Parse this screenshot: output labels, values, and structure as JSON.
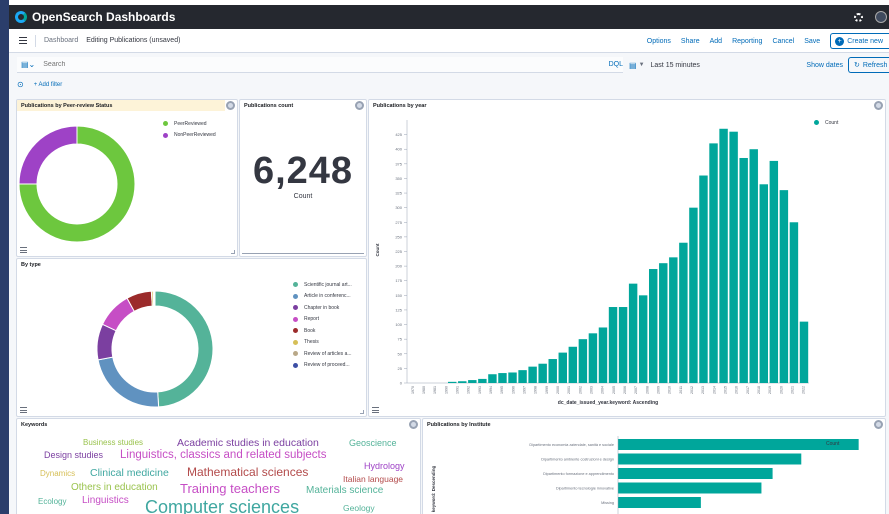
{
  "app": {
    "name": "OpenSearch Dashboards"
  },
  "breadcrumbs": [
    "Dashboard",
    "Editing Publications (unsaved)"
  ],
  "nav_actions": [
    "Options",
    "Share",
    "Add",
    "Reporting",
    "Cancel",
    "Save"
  ],
  "create_button": "Create new",
  "query": {
    "placeholder": "Search",
    "language": "DQL"
  },
  "time": {
    "range": "Last 15 minutes",
    "show_dates": "Show dates",
    "refresh": "Refresh"
  },
  "filters": {
    "add_label": "+ Add filter"
  },
  "colors": {
    "header": "#25282f",
    "link": "#006bb8",
    "teal": "#54b399",
    "bar": "#00a69b"
  },
  "panels": {
    "peer_review": {
      "title": "Publications by Peer-review Status",
      "chart_data": {
        "type": "pie",
        "labels": [
          "PeerReviewed",
          "NonPeerReviewed"
        ],
        "values": [
          75,
          25
        ],
        "colors": [
          "#6dc73e",
          "#9e42c6"
        ],
        "legend": "top-right"
      }
    },
    "count": {
      "title": "Publications count",
      "value": "6,248",
      "label": "Count"
    },
    "by_year": {
      "title": "Publications by year",
      "chart_data": {
        "type": "bar",
        "categories": [
          "1970",
          "1980",
          "1981",
          "1990",
          "1991",
          "1992",
          "1993",
          "1994",
          "1995",
          "1996",
          "1997",
          "1998",
          "1999",
          "2000",
          "2001",
          "2002",
          "2003",
          "2004",
          "2005",
          "2006",
          "2007",
          "2008",
          "2009",
          "2010",
          "2011",
          "2012",
          "2013",
          "2014",
          "2015",
          "2016",
          "2017",
          "2018",
          "2019",
          "2020",
          "2021",
          "2022"
        ],
        "values": [
          0,
          0,
          0,
          0,
          2,
          3,
          5,
          7,
          15,
          17,
          18,
          22,
          28,
          33,
          41,
          52,
          62,
          75,
          85,
          95,
          130,
          130,
          170,
          150,
          195,
          205,
          215,
          240,
          300,
          355,
          410,
          435,
          430,
          385,
          400,
          340,
          380,
          330,
          275,
          105
        ],
        "ylabel": "Count",
        "xlabel": "dc_date_issued_year.keyword: Ascending",
        "yticks": [
          0,
          25,
          50,
          75,
          100,
          125,
          150,
          175,
          200,
          225,
          250,
          275,
          300,
          325,
          350,
          375,
          400,
          425
        ],
        "ylim": [
          0,
          450
        ],
        "series": [
          {
            "name": "Count",
            "color": "#00a69b"
          }
        ],
        "legend": "top-right"
      }
    },
    "by_type": {
      "title": "By type",
      "chart_data": {
        "type": "pie",
        "labels": [
          "Scientific journal art...",
          "Article in conferenc...",
          "Chapter in book",
          "Report",
          "Book",
          "Thesis",
          "Review of articles a...",
          "Review of proceed..."
        ],
        "values": [
          49,
          23,
          10,
          10,
          7,
          0.5,
          0.3,
          0.2
        ],
        "colors": [
          "#54b399",
          "#6092c0",
          "#7b3fa0",
          "#c64ec5",
          "#9b2b2b",
          "#d6bf57",
          "#b9a888",
          "#3d4fa5"
        ],
        "legend": "right"
      }
    },
    "keywords": {
      "title": "Keywords",
      "words": [
        {
          "text": "Business studies",
          "color": "#9ac34e",
          "size": 8
        },
        {
          "text": "Academic studies in education",
          "color": "#7b3fa0",
          "size": 10.5
        },
        {
          "text": "Geoscience",
          "color": "#54b399",
          "size": 9
        },
        {
          "text": "Design studies",
          "color": "#7b3fa0",
          "size": 9
        },
        {
          "text": "Linguistics, classics and related subjects",
          "color": "#c64ec5",
          "size": 11.5
        },
        {
          "text": "Hydrology",
          "color": "#9e42c6",
          "size": 9
        },
        {
          "text": "Dynamics",
          "color": "#d6bf57",
          "size": 8
        },
        {
          "text": "Clinical medicine",
          "color": "#3fa7a0",
          "size": 10.5
        },
        {
          "text": "Mathematical sciences",
          "color": "#b34b4b",
          "size": 12
        },
        {
          "text": "Italian language",
          "color": "#b34b4b",
          "size": 8.5
        },
        {
          "text": "Others in education",
          "color": "#9ac34e",
          "size": 10
        },
        {
          "text": "Training teachers",
          "color": "#c64ec5",
          "size": 13
        },
        {
          "text": "Materials science",
          "color": "#54b399",
          "size": 10
        },
        {
          "text": "Ecology",
          "color": "#54b399",
          "size": 8
        },
        {
          "text": "Linguistics",
          "color": "#c64ec5",
          "size": 10
        },
        {
          "text": "Computer sciences",
          "color": "#3fa7a0",
          "size": 18
        },
        {
          "text": "Geology",
          "color": "#54b399",
          "size": 8.5
        }
      ]
    },
    "by_institute": {
      "title": "Publications by Institute",
      "chart_data": {
        "type": "bar",
        "orientation": "horizontal",
        "categories": [
          "Dipartimento economia aziendale, sanità e sociale",
          "Dipartimento ambiente costruzioni e design",
          "Dipartimento formazione e apprendimento",
          "Dipartimento tecnologie innovative",
          "Missing"
        ],
        "values": [
          1510,
          1150,
          970,
          900,
          520
        ],
        "ylabel": "keyword: Descending",
        "series": [
          {
            "name": "Count",
            "color": "#00a69b"
          }
        ],
        "legend": "top-right"
      }
    }
  }
}
